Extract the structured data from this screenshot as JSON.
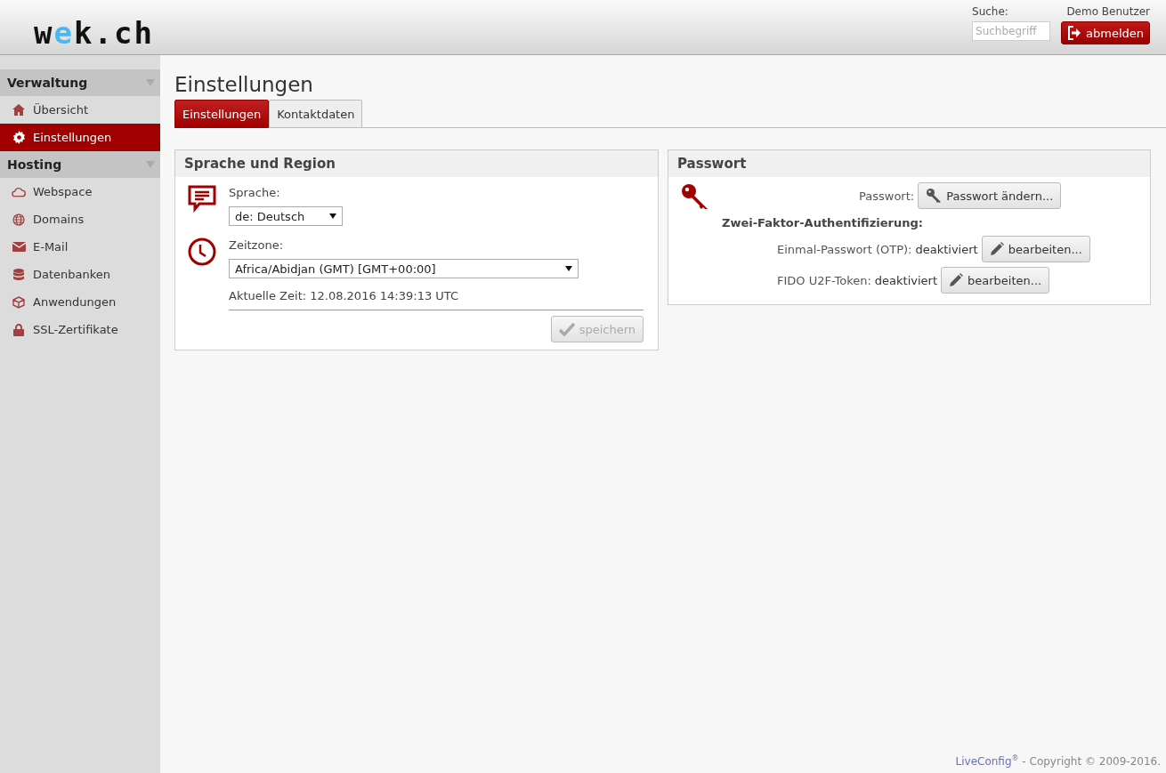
{
  "header": {
    "logo": "wek.ch",
    "search_label": "Suche:",
    "search": {
      "placeholder": "Suchbegriff"
    },
    "user": "Demo Benutzer",
    "logout_button": "abmelden"
  },
  "sidebar": {
    "sections": [
      {
        "title": "Verwaltung",
        "expanded": true,
        "items": [
          {
            "label": "Übersicht",
            "kind": "home",
            "selected": false
          },
          {
            "label": "Einstellungen",
            "kind": "gear",
            "selected": true
          }
        ]
      },
      {
        "title": "Hosting",
        "expanded": true,
        "items": [
          {
            "label": "Webspace",
            "kind": "cloud",
            "selected": false
          },
          {
            "label": "Domains",
            "kind": "globe",
            "selected": false
          },
          {
            "label": "E-Mail",
            "kind": "mail",
            "selected": false
          },
          {
            "label": "Datenbanken",
            "kind": "database",
            "selected": false
          },
          {
            "label": "Anwendungen",
            "kind": "cube",
            "selected": false
          },
          {
            "label": "SSL-Zertifikate",
            "kind": "lock",
            "selected": false
          }
        ]
      }
    ]
  },
  "page_title": "Einstellungen",
  "tabs": [
    {
      "label": "Einstellungen",
      "selected": true
    },
    {
      "label": "Kontaktdaten",
      "selected": false
    }
  ],
  "language_panel": {
    "title": "Sprache und Region",
    "language_label": "Sprache:",
    "language_value": "de: Deutsch",
    "timezone_label": "Zeitzone:",
    "timezone_value": "Africa/Abidjan (GMT) [GMT+00:00]",
    "current_time": "Aktuelle Zeit: 12.08.2016 14:39:13 UTC",
    "save_button": {
      "label": "speichern",
      "disabled": true
    }
  },
  "password_panel": {
    "title": "Passwort",
    "password_label": "Passwort:",
    "change_button": "Passwort ändern...",
    "twofactor_title": "Zwei-Faktor-Authentifizierung:",
    "rows": [
      {
        "label": "Einmal-Passwort (OTP):",
        "status": "deaktiviert",
        "button": "bearbeiten..."
      },
      {
        "label": "FIDO U2F-Token:",
        "status": "deaktiviert",
        "button": "bearbeiten..."
      }
    ]
  },
  "footer": {
    "link": "LiveConfig$^{®}$",
    "text": " - Copyright © 2009-2016."
  }
}
